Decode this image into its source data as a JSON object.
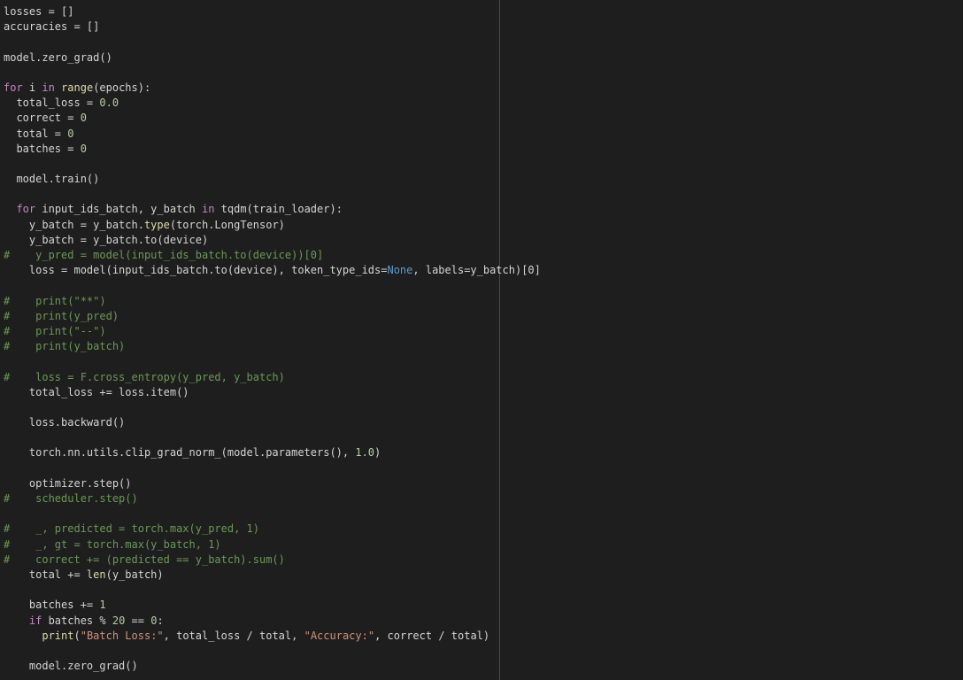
{
  "editor": {
    "lines": [
      [
        {
          "t": "losses = []",
          "c": "plain"
        }
      ],
      [
        {
          "t": "accuracies = []",
          "c": "plain"
        }
      ],
      [],
      [
        {
          "t": "model.zero_grad()",
          "c": "plain"
        }
      ],
      [],
      [
        {
          "t": "for",
          "c": "kw"
        },
        {
          "t": " i ",
          "c": "plain"
        },
        {
          "t": "in",
          "c": "kw"
        },
        {
          "t": " ",
          "c": "plain"
        },
        {
          "t": "range",
          "c": "fn"
        },
        {
          "t": "(epochs):",
          "c": "plain"
        }
      ],
      [
        {
          "t": "  total_loss = ",
          "c": "plain"
        },
        {
          "t": "0.0",
          "c": "num"
        }
      ],
      [
        {
          "t": "  correct = ",
          "c": "plain"
        },
        {
          "t": "0",
          "c": "num"
        }
      ],
      [
        {
          "t": "  total = ",
          "c": "plain"
        },
        {
          "t": "0",
          "c": "num"
        }
      ],
      [
        {
          "t": "  batches = ",
          "c": "plain"
        },
        {
          "t": "0",
          "c": "num"
        }
      ],
      [],
      [
        {
          "t": "  model.train()",
          "c": "plain"
        }
      ],
      [],
      [
        {
          "t": "  ",
          "c": "plain"
        },
        {
          "t": "for",
          "c": "kw"
        },
        {
          "t": " input_ids_batch, y_batch ",
          "c": "plain"
        },
        {
          "t": "in",
          "c": "kw"
        },
        {
          "t": " tqdm(train_loader):",
          "c": "plain"
        }
      ],
      [
        {
          "t": "    y_batch = y_batch.",
          "c": "plain"
        },
        {
          "t": "type",
          "c": "fn"
        },
        {
          "t": "(torch.LongTensor)",
          "c": "plain"
        }
      ],
      [
        {
          "t": "    y_batch = y_batch.to(device)",
          "c": "plain"
        }
      ],
      [
        {
          "t": "#    y_pred = model(input_ids_batch.to(device))[0]",
          "c": "com"
        }
      ],
      [
        {
          "t": "    loss = model(input_ids_batch.to(device), token_type_ids=",
          "c": "plain"
        },
        {
          "t": "None",
          "c": "const"
        },
        {
          "t": ", labels=y_batch)[0]",
          "c": "plain"
        }
      ],
      [],
      [
        {
          "t": "#    print(\"**\")",
          "c": "com"
        }
      ],
      [
        {
          "t": "#    print(y_pred)",
          "c": "com"
        }
      ],
      [
        {
          "t": "#    print(\"--\")",
          "c": "com"
        }
      ],
      [
        {
          "t": "#    print(y_batch)",
          "c": "com"
        }
      ],
      [],
      [
        {
          "t": "#    loss = F.cross_entropy(y_pred, y_batch)",
          "c": "com"
        }
      ],
      [
        {
          "t": "    total_loss += loss.item()",
          "c": "plain"
        }
      ],
      [],
      [
        {
          "t": "    loss.backward()",
          "c": "plain"
        }
      ],
      [],
      [
        {
          "t": "    torch.nn.utils.clip_grad_norm_(model.parameters(), ",
          "c": "plain"
        },
        {
          "t": "1.0",
          "c": "num"
        },
        {
          "t": ")",
          "c": "plain"
        }
      ],
      [],
      [
        {
          "t": "    optimizer.step()",
          "c": "plain"
        }
      ],
      [
        {
          "t": "#    scheduler.step()",
          "c": "com"
        }
      ],
      [],
      [
        {
          "t": "#    _, predicted = torch.max(y_pred, 1)",
          "c": "com"
        }
      ],
      [
        {
          "t": "#    _, gt = torch.max(y_batch, 1)",
          "c": "com"
        }
      ],
      [
        {
          "t": "#    correct += (predicted == y_batch).sum()",
          "c": "com"
        }
      ],
      [
        {
          "t": "    total += ",
          "c": "plain"
        },
        {
          "t": "len",
          "c": "fn"
        },
        {
          "t": "(y_batch)",
          "c": "plain"
        }
      ],
      [],
      [
        {
          "t": "    batches += ",
          "c": "plain"
        },
        {
          "t": "1",
          "c": "num"
        }
      ],
      [
        {
          "t": "    ",
          "c": "plain"
        },
        {
          "t": "if",
          "c": "kw"
        },
        {
          "t": " batches % ",
          "c": "plain"
        },
        {
          "t": "20",
          "c": "num"
        },
        {
          "t": " == ",
          "c": "plain"
        },
        {
          "t": "0",
          "c": "num"
        },
        {
          "t": ":",
          "c": "plain"
        }
      ],
      [
        {
          "t": "      ",
          "c": "plain"
        },
        {
          "t": "print",
          "c": "fn"
        },
        {
          "t": "(",
          "c": "plain"
        },
        {
          "t": "\"Batch Loss:\"",
          "c": "str"
        },
        {
          "t": ", total_loss / total, ",
          "c": "plain"
        },
        {
          "t": "\"Accuracy:\"",
          "c": "str"
        },
        {
          "t": ", correct / total)",
          "c": "plain"
        }
      ],
      [],
      [
        {
          "t": "    model.zero_grad()",
          "c": "plain"
        }
      ]
    ]
  },
  "colors": {
    "background": "#1e1e1e",
    "keyword": "#c586c0",
    "function": "#dcdcaa",
    "number": "#b5cea8",
    "string": "#ce9178",
    "constant": "#569cd6",
    "comment": "#6a9955",
    "text": "#d4d4d4"
  }
}
